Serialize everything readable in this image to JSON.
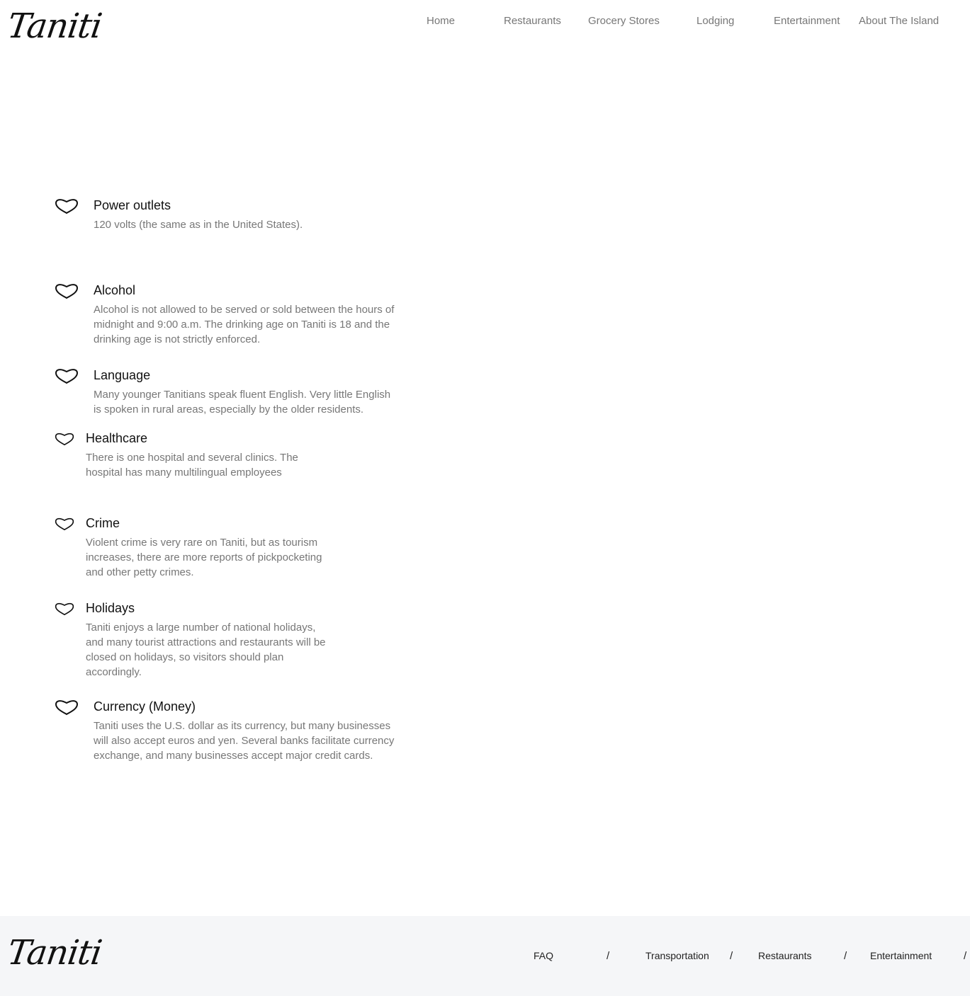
{
  "header": {
    "logo_text": "Taniti",
    "nav": [
      {
        "label": "Home"
      },
      {
        "label": "Restaurants"
      },
      {
        "label": "Grocery Stores"
      },
      {
        "label": "Lodging"
      },
      {
        "label": "Entertainment"
      },
      {
        "label": "About The Island"
      }
    ]
  },
  "info": [
    {
      "icon": "heart-icon",
      "title": "Power outlets",
      "desc": "120 volts (the same as in the United States)."
    },
    {
      "icon": "heart-icon",
      "title": "Alcohol",
      "desc": "Alcohol is not allowed to be served or sold between the hours of midnight and 9:00 a.m. The drinking age on Taniti is 18 and the drinking age is not strictly enforced."
    },
    {
      "icon": "heart-icon",
      "title": "Language",
      "desc": "Many younger Tanitians speak fluent English. Very little English is spoken in rural areas, especially by the older residents."
    },
    {
      "icon": "heart-icon",
      "title": "Healthcare",
      "desc": "There is one hospital and several clinics. The hospital has many multilingual employees"
    },
    {
      "icon": "heart-icon",
      "title": "Crime",
      "desc": "Violent crime is very rare on Taniti, but as tourism increases, there are more reports of pickpocketing and other petty crimes."
    },
    {
      "icon": "heart-icon",
      "title": "Holidays",
      "desc": "Taniti enjoys a large number of national holidays, and many tourist attractions and restaurants will be closed on holidays, so visitors should plan accordingly."
    },
    {
      "icon": "heart-icon",
      "title": "Currency (Money)",
      "desc": "Taniti uses the U.S. dollar as its currency, but many businesses will also accept euros and yen. Several banks facilitate currency exchange, and many businesses accept major credit cards."
    }
  ],
  "footer": {
    "logo_text": "Taniti",
    "links": [
      {
        "label": "FAQ"
      },
      {
        "label": "Transportation"
      },
      {
        "label": "Restaurants"
      },
      {
        "label": "Entertainment"
      }
    ],
    "separator": "/"
  }
}
